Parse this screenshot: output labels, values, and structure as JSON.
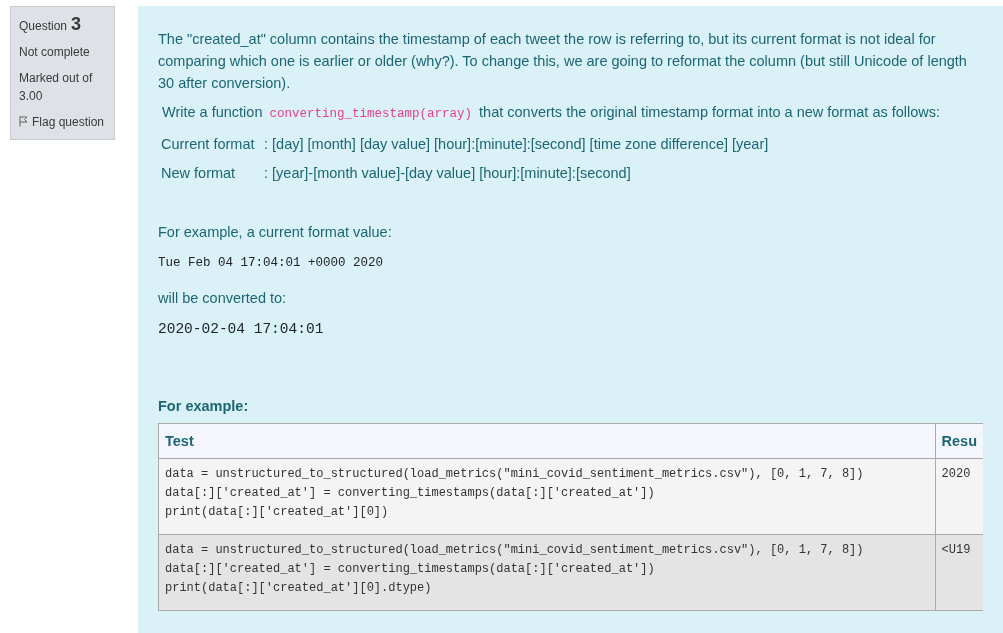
{
  "question_info": {
    "label": "Question",
    "number": "3",
    "status": "Not complete",
    "marks": "Marked out of 3.00",
    "flag": "Flag question"
  },
  "intro": "The \"created_at\" column contains the timestamp of each tweet the row is referring to, but its current format is not ideal for comparing which one is earlier or older (why?). To change this, we are going to reformat the column (but still Unicode of length 30 after conversion).",
  "instruction": {
    "before": "Write a function",
    "code": "converting_timestamp(array)",
    "after": "that converts the original timestamp format into a new format as follows:"
  },
  "formats": [
    {
      "label": "Current format",
      "value": ": [day] [month] [day value] [hour]:[minute]:[second] [time zone difference] [year]"
    },
    {
      "label": "New format",
      "value": ": [year]-[month value]-[day value] [hour]:[minute]:[second]"
    }
  ],
  "example_intro": "For example, a current format value:",
  "example_input": "Tue Feb 04 17:04:01 +0000 2020",
  "example_mid": "will be converted to:",
  "example_output": "2020-02-04 17:04:01",
  "examples_heading": "For example:",
  "table": {
    "columns": [
      "Test",
      "Resu"
    ],
    "rows": [
      {
        "test": "data = unstructured_to_structured(load_metrics(\"mini_covid_sentiment_metrics.csv\"), [0, 1, 7, 8])\ndata[:]['created_at'] = converting_timestamps(data[:]['created_at'])\nprint(data[:]['created_at'][0])",
        "result": "2020"
      },
      {
        "test": "data = unstructured_to_structured(load_metrics(\"mini_covid_sentiment_metrics.csv\"), [0, 1, 7, 8])\ndata[:]['created_at'] = converting_timestamps(data[:]['created_at'])\nprint(data[:]['created_at'][0].dtype)",
        "result": "<U19"
      }
    ]
  }
}
